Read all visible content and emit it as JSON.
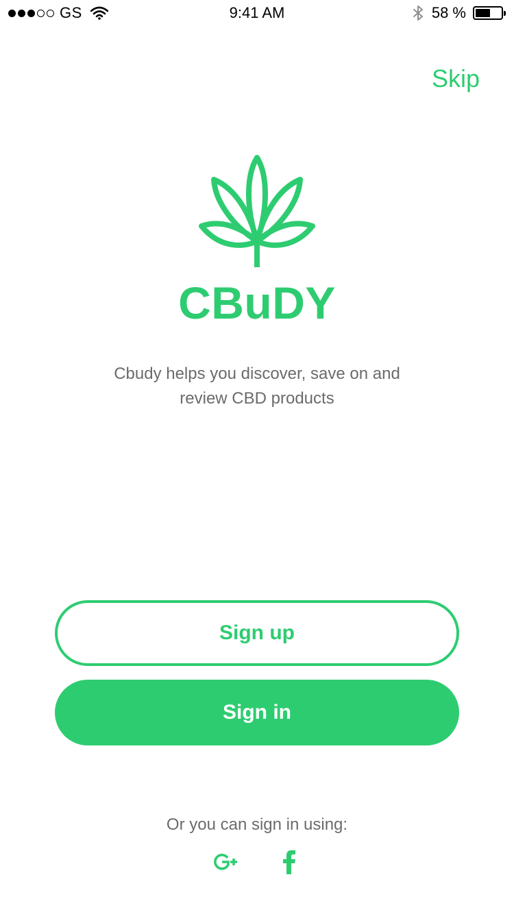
{
  "status_bar": {
    "carrier": "GS",
    "time": "9:41 AM",
    "battery_percent": "58 %",
    "battery_level": 0.58,
    "signal_bars_filled": 3,
    "signal_bars_total": 5
  },
  "header": {
    "skip_label": "Skip"
  },
  "brand": {
    "name": "CBuDY",
    "tagline": "Cbudy helps you discover, save on and review CBD products",
    "logo_icon": "cannabis-leaf-icon"
  },
  "actions": {
    "sign_up_label": "Sign up",
    "sign_in_label": "Sign in"
  },
  "social": {
    "prompt": "Or you can sign in using:",
    "providers": [
      "google-plus-icon",
      "facebook-icon"
    ]
  },
  "colors": {
    "accent": "#2ecc71",
    "text_muted": "#6b6b6b",
    "background": "#ffffff"
  }
}
